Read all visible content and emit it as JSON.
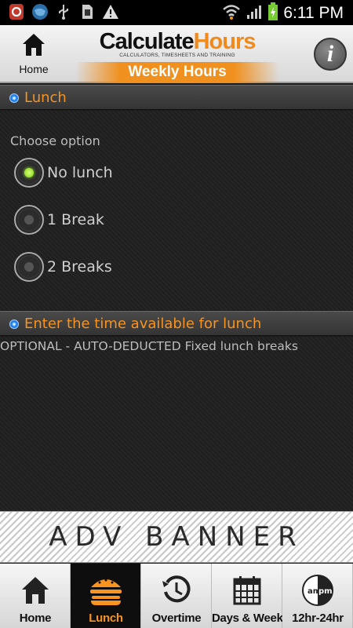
{
  "status_bar": {
    "time": "6:11 PM",
    "icons": [
      "app-shield-icon",
      "globe-icon",
      "usb-icon",
      "sd-card-icon",
      "warning-icon",
      "wifi-icon",
      "signal-icon",
      "battery-charging-icon"
    ]
  },
  "header": {
    "home_label": "Home",
    "logo_calc": "Calculate",
    "logo_hours": "Hours",
    "logo_tagline": "CALCULATORS, TIMESHEETS AND TRAINING",
    "subtitle": "Weekly Hours",
    "info_label": "i"
  },
  "lunch_section": {
    "title": "Lunch",
    "choose_label": "Choose option",
    "options": [
      {
        "label": "No lunch",
        "selected": true
      },
      {
        "label": "1 Break",
        "selected": false
      },
      {
        "label": "2 Breaks",
        "selected": false
      }
    ]
  },
  "time_section": {
    "title": "Enter the time available for lunch",
    "note": "OPTIONAL - AUTO-DEDUCTED Fixed lunch breaks"
  },
  "banner": {
    "text": "ADV BANNER"
  },
  "tabs": [
    {
      "label": "Home",
      "icon": "home-icon",
      "active": false
    },
    {
      "label": "Lunch",
      "icon": "burger-icon",
      "active": true
    },
    {
      "label": "Overtime",
      "icon": "clock-icon",
      "active": false
    },
    {
      "label": "Days & Weeks",
      "icon": "calendar-icon",
      "active": false
    },
    {
      "label": "12hr-24hr",
      "icon": "am-pm-icon",
      "active": false
    }
  ],
  "colors": {
    "accent_orange": "#f7931e",
    "selected_green": "#7fd40a",
    "section_dot_blue": "#2a8cff"
  }
}
